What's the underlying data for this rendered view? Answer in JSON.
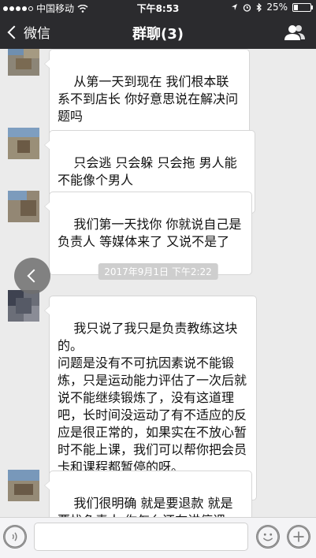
{
  "status_bar": {
    "carrier": "中国移动",
    "time": "下午8:53",
    "battery": "25%"
  },
  "nav": {
    "back_label": "微信",
    "title": "群聊(3)"
  },
  "messages": [
    {
      "text": "从第一天到现在 我们根本联系不到店长 你好意思说在解决问题吗"
    },
    {
      "text": "只会逃 只会躲 只会拖 男人能不能像个男人"
    },
    {
      "text": "我们第一天找你 你就说自己是负责人 等媒体来了 又说不是了"
    },
    {
      "text": "我只说了我只是负责教练这块的。\n问题是没有不可抗因素说不能锻炼，只是运动能力评估了一次后就说不能继续锻炼了，没有这道理吧，长时间没运动了有不适应的反应是很正常的，如果实在不放心暂时不能上课，我们可以帮你把会员卡和课程都暂停的呀。"
    },
    {
      "text": "我们很明确 就是要退款 就是要找负责人 你怎么还在讲停课"
    }
  ],
  "timestamp": "2017年9月1日 下午2:22",
  "icons": {
    "back": "chevron-left-icon",
    "group_info": "people-icon",
    "voice": "voice-icon",
    "emoji": "emoji-icon",
    "more": "plus-icon",
    "floating_back": "chevron-left-icon"
  },
  "colors": {
    "nav_bg": "#2b2b2e",
    "chat_bg": "#ebebeb",
    "bubble_bg": "#ffffff",
    "timestamp_bg": "#cecece"
  }
}
